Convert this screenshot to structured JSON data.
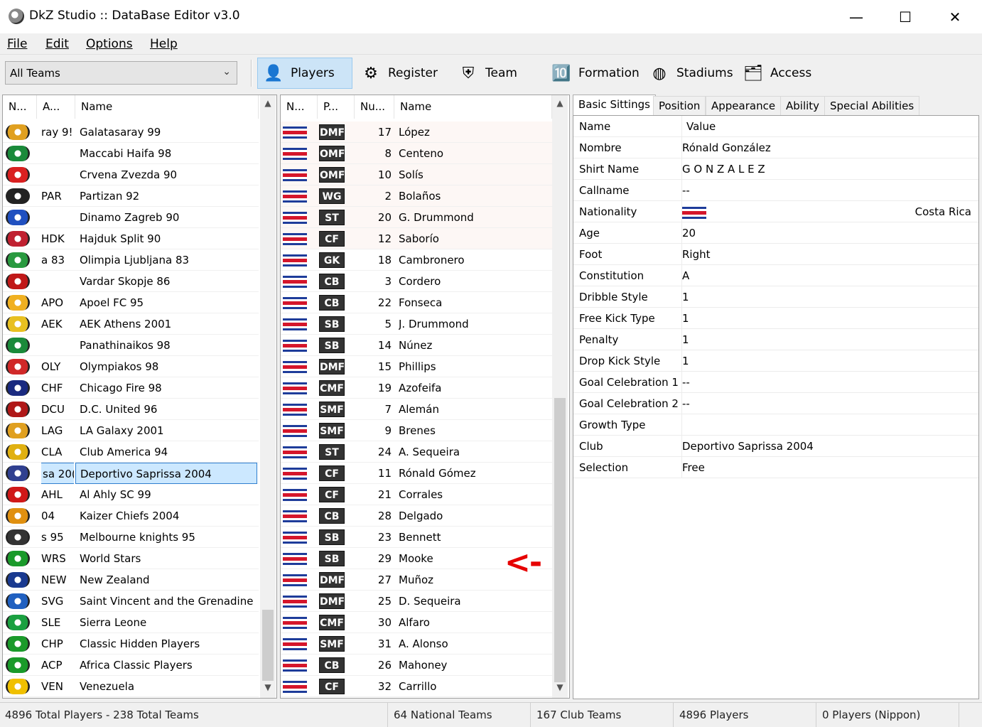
{
  "window": {
    "title": "DkZ Studio :: DataBase Editor v3.0",
    "minimize": "—",
    "maximize": "☐",
    "close": "✕"
  },
  "menu": [
    "File",
    "Edit",
    "Options",
    "Help"
  ],
  "toolbar": {
    "team_filter": "All Teams",
    "buttons": [
      {
        "label": "Players",
        "icon": "player-icon",
        "glyph": "👤"
      },
      {
        "label": "Register",
        "icon": "register-icon",
        "glyph": "⚙"
      },
      {
        "label": "Team",
        "icon": "team-icon",
        "glyph": "⛨"
      },
      {
        "label": "Formation",
        "icon": "formation-icon",
        "glyph": "🔟"
      },
      {
        "label": "Stadiums",
        "icon": "stadium-icon",
        "glyph": "◍"
      },
      {
        "label": "Access",
        "icon": "access-icon",
        "glyph": "🗂"
      }
    ]
  },
  "teams": {
    "columns": [
      "N...",
      "A...",
      "Name"
    ],
    "rows": [
      {
        "abbr": "ray 9!",
        "name": "Galatasaray 99",
        "crest": "#e0a020"
      },
      {
        "abbr": "",
        "name": "Maccabi Haifa 98",
        "crest": "#1a8a3a"
      },
      {
        "abbr": "",
        "name": "Crvena Zvezda 90",
        "crest": "#d92020"
      },
      {
        "abbr": "PAR",
        "name": "Partizan 92",
        "crest": "#222222"
      },
      {
        "abbr": "",
        "name": "Dinamo Zagreb 90",
        "crest": "#2050c0"
      },
      {
        "abbr": "HDK",
        "name": "Hajduk Split 90",
        "crest": "#c02030"
      },
      {
        "abbr": "a 83",
        "name": "Olimpia Ljubljana 83",
        "crest": "#2a9a40"
      },
      {
        "abbr": "",
        "name": "Vardar Skopje 86",
        "crest": "#c01818"
      },
      {
        "abbr": "APO",
        "name": "Apoel FC 95",
        "crest": "#f0b020"
      },
      {
        "abbr": "AEK",
        "name": "AEK Athens 2001",
        "crest": "#e8c020"
      },
      {
        "abbr": "",
        "name": "Panathinaikos 98",
        "crest": "#1a8a3a"
      },
      {
        "abbr": "OLY",
        "name": "Olympiakos 98",
        "crest": "#d02828"
      },
      {
        "abbr": "CHF",
        "name": "Chicago Fire 98",
        "crest": "#1a2a80"
      },
      {
        "abbr": "DCU",
        "name": "D.C. United 96",
        "crest": "#b01818"
      },
      {
        "abbr": "LAG",
        "name": "LA Galaxy 2001",
        "crest": "#e0a020"
      },
      {
        "abbr": "CLA",
        "name": "Club America 94",
        "crest": "#e0b010"
      },
      {
        "abbr": "sa 20(",
        "name": "Deportivo Saprissa 2004",
        "crest": "#304090",
        "selected": true
      },
      {
        "abbr": "AHL",
        "name": "Al Ahly SC 99",
        "crest": "#d01818"
      },
      {
        "abbr": "04",
        "name": "Kaizer Chiefs 2004",
        "crest": "#e09010"
      },
      {
        "abbr": "s 95",
        "name": "Melbourne knights 95",
        "crest": "#333333"
      },
      {
        "abbr": "WRS",
        "name": "World Stars",
        "crest": "#1a9a2a"
      },
      {
        "abbr": "NEW",
        "name": "New Zealand",
        "crest": "#1a3a90"
      },
      {
        "abbr": "SVG",
        "name": "Saint Vincent and the Grenadine",
        "crest": "#2060c0"
      },
      {
        "abbr": "SLE",
        "name": "Sierra Leone",
        "crest": "#1aa040"
      },
      {
        "abbr": "CHP",
        "name": "Classic Hidden Players",
        "crest": "#1a9a2a"
      },
      {
        "abbr": "ACP",
        "name": "Africa Classic Players",
        "crest": "#1a9a2a"
      },
      {
        "abbr": "VEN",
        "name": "Venezuela",
        "crest": "#f0c000"
      }
    ]
  },
  "players": {
    "columns": [
      "N...",
      "P...",
      "Nu...",
      "Name"
    ],
    "rows": [
      {
        "pos": "DMF",
        "num": "17",
        "name": "López"
      },
      {
        "pos": "OMF",
        "num": "8",
        "name": "Centeno"
      },
      {
        "pos": "OMF",
        "num": "10",
        "name": "Solís"
      },
      {
        "pos": "WG",
        "num": "2",
        "name": "Bolaños"
      },
      {
        "pos": "ST",
        "num": "20",
        "name": "G. Drummond"
      },
      {
        "pos": "CF",
        "num": "12",
        "name": "Saborío"
      },
      {
        "pos": "GK",
        "num": "18",
        "name": "Cambronero"
      },
      {
        "pos": "CB",
        "num": "3",
        "name": "Cordero"
      },
      {
        "pos": "CB",
        "num": "22",
        "name": "Fonseca"
      },
      {
        "pos": "SB",
        "num": "5",
        "name": "J. Drummond"
      },
      {
        "pos": "SB",
        "num": "14",
        "name": "Núnez"
      },
      {
        "pos": "DMF",
        "num": "15",
        "name": "Phillips"
      },
      {
        "pos": "CMF",
        "num": "19",
        "name": "Azofeifa"
      },
      {
        "pos": "SMF",
        "num": "7",
        "name": "Alemán"
      },
      {
        "pos": "SMF",
        "num": "9",
        "name": "Brenes"
      },
      {
        "pos": "ST",
        "num": "24",
        "name": "A. Sequeira"
      },
      {
        "pos": "CF",
        "num": "11",
        "name": "Rónald Gómez"
      },
      {
        "pos": "CF",
        "num": "21",
        "name": "Corrales"
      },
      {
        "pos": "CB",
        "num": "28",
        "name": "Delgado"
      },
      {
        "pos": "SB",
        "num": "23",
        "name": "Bennett"
      },
      {
        "pos": "SB",
        "num": "29",
        "name": "Mooke"
      },
      {
        "pos": "DMF",
        "num": "27",
        "name": "Muñoz"
      },
      {
        "pos": "DMF",
        "num": "25",
        "name": "D. Sequeira"
      },
      {
        "pos": "CMF",
        "num": "30",
        "name": "Alfaro"
      },
      {
        "pos": "SMF",
        "num": "31",
        "name": "A. Alonso"
      },
      {
        "pos": "CB",
        "num": "26",
        "name": "Mahoney"
      },
      {
        "pos": "CF",
        "num": "32",
        "name": "Carrillo"
      }
    ],
    "annotation": "<-"
  },
  "details": {
    "tabs": [
      "Basic Sittings",
      "Position",
      "Appearance",
      "Ability",
      "Special Abilities"
    ],
    "header": {
      "key": "Name",
      "value": "Value"
    },
    "rows": [
      {
        "key": "Nombre",
        "value": "Rónald González"
      },
      {
        "key": "Shirt Name",
        "value": "G O N Z A L E Z"
      },
      {
        "key": "Callname",
        "value": "--"
      },
      {
        "key": "Nationality",
        "value": "Costa Rica",
        "flag": true
      },
      {
        "key": "Age",
        "value": "20"
      },
      {
        "key": "Foot",
        "value": "Right"
      },
      {
        "key": "Constitution",
        "value": "A"
      },
      {
        "key": "Dribble Style",
        "value": "1"
      },
      {
        "key": "Free Kick Type",
        "value": "1"
      },
      {
        "key": "Penalty",
        "value": "1"
      },
      {
        "key": "Drop Kick Style",
        "value": "1"
      },
      {
        "key": "Goal Celebration 1",
        "value": "--"
      },
      {
        "key": "Goal Celebration 2",
        "value": "--"
      },
      {
        "key": "Growth Type",
        "value": ""
      },
      {
        "key": "Club",
        "value": "Deportivo Saprissa 2004"
      },
      {
        "key": "Selection",
        "value": "Free"
      }
    ]
  },
  "status": [
    "4896 Total Players  -  238 Total Teams",
    "64 National Teams",
    "167 Club Teams",
    "4896 Players",
    "0 Players (Nippon)"
  ]
}
